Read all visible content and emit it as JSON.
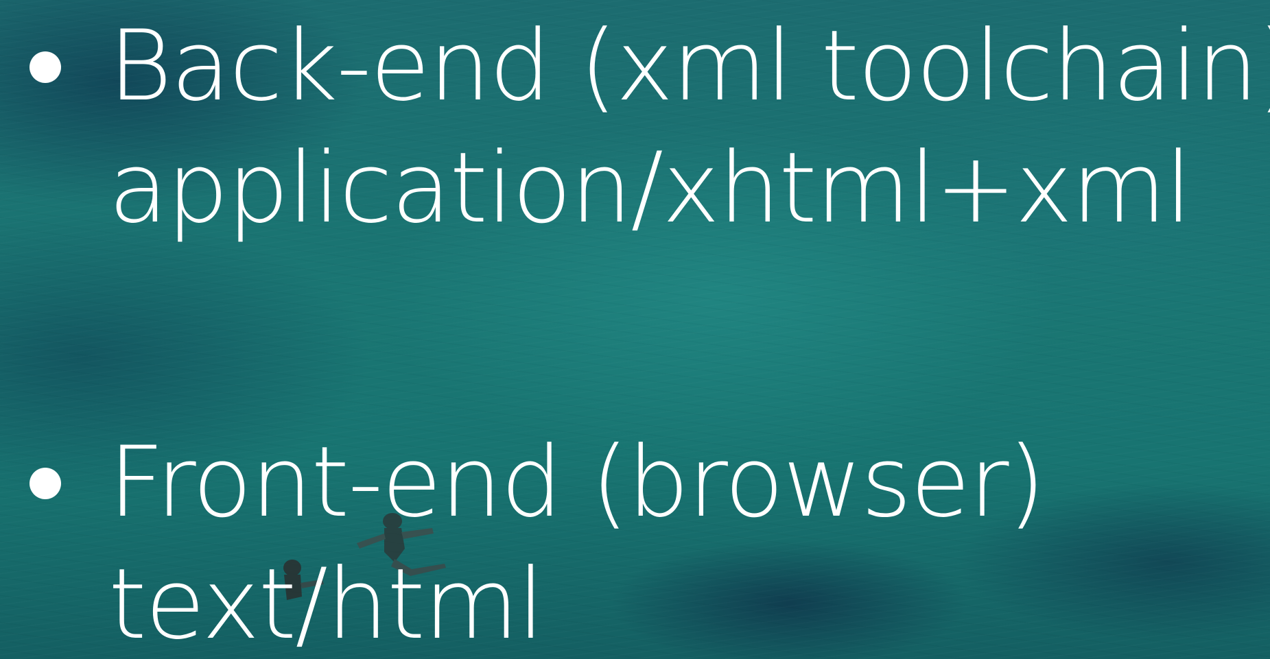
{
  "slide": {
    "background_color": "#1b6f6e",
    "text_color": "#ffffff",
    "bullets": [
      {
        "heading": "Back-end (xml toolchain)",
        "detail": "application/xhtml+xml"
      },
      {
        "heading": "Front-end (browser)",
        "detail": "text/html"
      }
    ]
  }
}
